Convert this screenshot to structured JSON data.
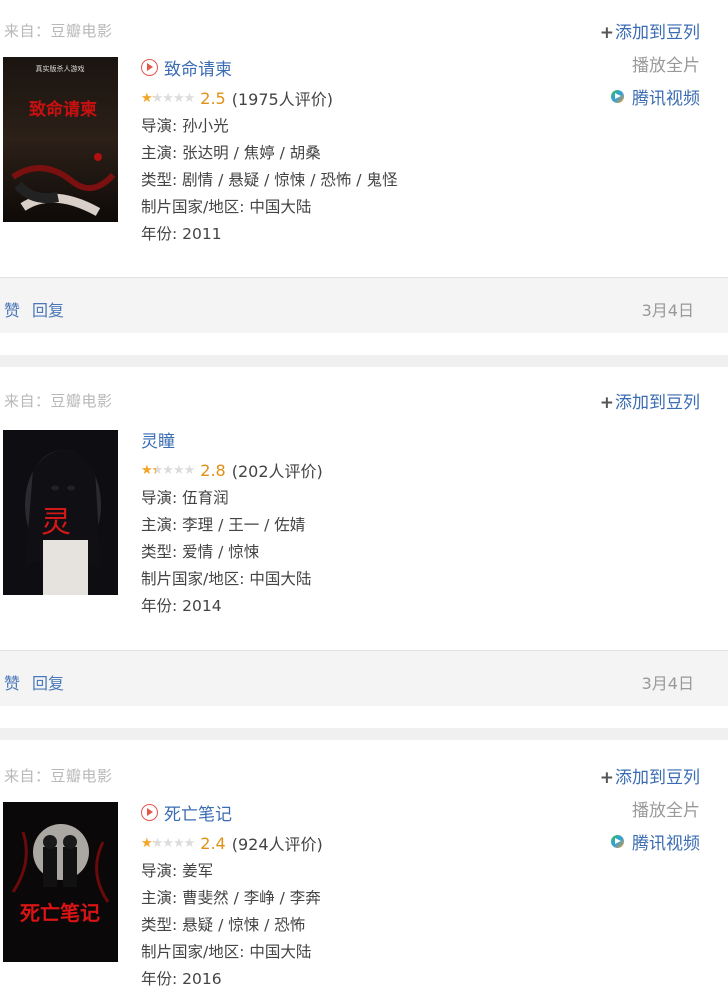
{
  "items": [
    {
      "source": "来自：豆瓣电影",
      "title": "致命请柬",
      "has_play_icon": true,
      "stars_fraction": 0.25,
      "score": "2.5",
      "votes": "(1975人评价)",
      "director": "导演: 孙小光",
      "cast": "主演: 张达明 / 焦婷 / 胡桑",
      "genre": "类型: 剧情 / 悬疑 / 惊悚 / 恐怖 / 鬼怪",
      "region": "制片国家/地区: 中国大陆",
      "year": "年份: 2011",
      "add_list": "添加到豆列",
      "play_full": "播放全片",
      "provider": "腾讯视频",
      "poster_texts": [
        "真实版杀人游戏",
        "致命请柬"
      ],
      "like": "赞",
      "reply": "回复",
      "date": "3月4日"
    },
    {
      "source": "来自：豆瓣电影",
      "title": "灵瞳",
      "has_play_icon": false,
      "stars_fraction": 0.28,
      "score": "2.8",
      "votes": "(202人评价)",
      "director": "导演: 伍育润",
      "cast": "主演: 李理 / 王一 / 佐婧",
      "genre": "类型: 爱情 / 惊悚",
      "region": "制片国家/地区: 中国大陆",
      "year": "年份: 2014",
      "add_list": "添加到豆列",
      "play_full": "",
      "provider": "",
      "poster_texts": [
        "灵"
      ],
      "like": "赞",
      "reply": "回复",
      "date": "3月4日"
    },
    {
      "source": "来自：豆瓣电影",
      "title": "死亡笔记",
      "has_play_icon": true,
      "stars_fraction": 0.24,
      "score": "2.4",
      "votes": "(924人评价)",
      "director": "导演: 姜军",
      "cast": "主演: 曹斐然 / 李峥 / 李奔",
      "genre": "类型: 悬疑 / 惊悚 / 恐怖",
      "region": "制片国家/地区: 中国大陆",
      "year": "年份: 2016",
      "add_list": "添加到豆列",
      "play_full": "播放全片",
      "provider": "腾讯视频",
      "poster_texts": [
        "死亡笔记"
      ]
    }
  ],
  "colors": {
    "link": "#3a6cb3",
    "star": "#f4a623",
    "score": "#e09015"
  },
  "icons": [
    "play-circle-icon",
    "star-rating-icon",
    "plus-icon",
    "tencent-video-icon"
  ]
}
